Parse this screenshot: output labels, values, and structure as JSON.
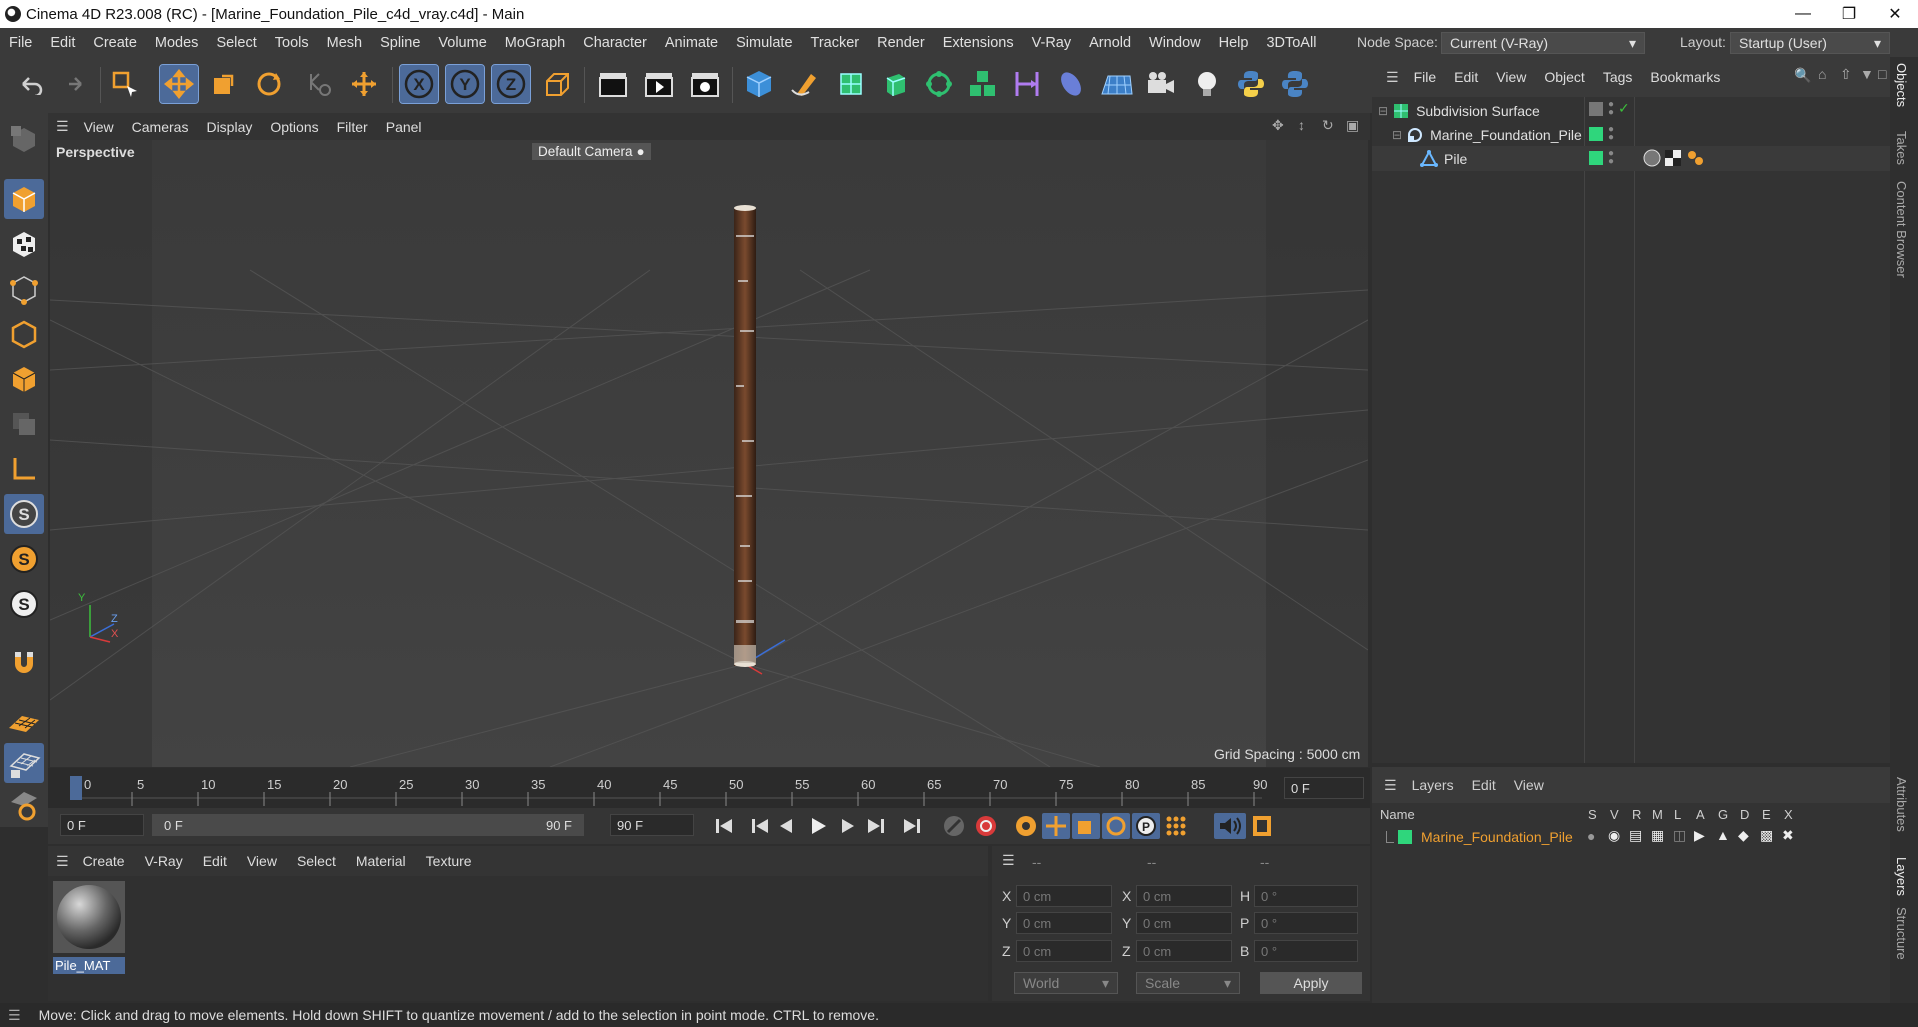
{
  "window": {
    "title": "Cinema 4D R23.008 (RC) - [Marine_Foundation_Pile_c4d_vray.c4d] - Main",
    "controls": [
      "minimize-icon",
      "restore-icon",
      "close-icon"
    ]
  },
  "menubar": {
    "items": [
      "File",
      "Edit",
      "Create",
      "Modes",
      "Select",
      "Tools",
      "Mesh",
      "Spline",
      "Volume",
      "MoGraph",
      "Character",
      "Animate",
      "Simulate",
      "Tracker",
      "Render",
      "Extensions",
      "V-Ray",
      "Arnold",
      "Window",
      "Help",
      "3DToAll"
    ],
    "node_space_label": "Node Space:",
    "node_space_value": "Current (V-Ray)",
    "layout_label": "Layout:",
    "layout_value": "Startup (User)"
  },
  "viewport": {
    "menu": [
      "View",
      "Cameras",
      "Display",
      "Options",
      "Filter",
      "Panel"
    ],
    "label": "Perspective",
    "camera": "Default Camera",
    "grid_spacing": "Grid Spacing : 5000 cm",
    "axis_labels": {
      "y": "Y",
      "z": "Z",
      "x": "X"
    }
  },
  "timeline": {
    "ticks": [
      "0",
      "5",
      "10",
      "15",
      "20",
      "25",
      "30",
      "35",
      "40",
      "45",
      "50",
      "55",
      "60",
      "65",
      "70",
      "75",
      "80",
      "85",
      "90"
    ],
    "current_frame": "0 F"
  },
  "playback": {
    "start": "0 F",
    "range_start": "0 F",
    "range_end": "90 F",
    "end": "90 F"
  },
  "material_manager": {
    "menu": [
      "Create",
      "V-Ray",
      "Edit",
      "View",
      "Select",
      "Material",
      "Texture"
    ],
    "materials": [
      {
        "name": "Pile_MAT"
      }
    ]
  },
  "coordinates": {
    "headers": [
      "--",
      "--",
      "--"
    ],
    "rows": [
      {
        "a_label": "X",
        "a_val": "0 cm",
        "b_label": "X",
        "b_val": "0 cm",
        "c_label": "H",
        "c_val": "0 °"
      },
      {
        "a_label": "Y",
        "a_val": "0 cm",
        "b_label": "Y",
        "b_val": "0 cm",
        "c_label": "P",
        "c_val": "0 °"
      },
      {
        "a_label": "Z",
        "a_val": "0 cm",
        "b_label": "Z",
        "b_val": "0 cm",
        "c_label": "B",
        "c_val": "0 °"
      }
    ],
    "world": "World",
    "scale": "Scale",
    "apply": "Apply"
  },
  "objects_panel": {
    "menu": [
      "File",
      "Edit",
      "View",
      "Object",
      "Tags",
      "Bookmarks"
    ],
    "objects": [
      {
        "name": "Subdivision Surface",
        "indent": 0
      },
      {
        "name": "Marine_Foundation_Pile",
        "indent": 1
      },
      {
        "name": "Pile",
        "indent": 2
      }
    ]
  },
  "layers_panel": {
    "menu": [
      "Layers",
      "Edit",
      "View"
    ],
    "header_name": "Name",
    "header_cols": [
      "S",
      "V",
      "R",
      "M",
      "L",
      "A",
      "G",
      "D",
      "E",
      "X"
    ],
    "layers": [
      {
        "name": "Marine_Foundation_Pile",
        "color": "#2fd67c"
      }
    ]
  },
  "side_tabs": [
    "Objects",
    "Takes",
    "Content Browser",
    "Attributes",
    "Layers",
    "Structure"
  ],
  "status": {
    "text": "Move: Click and drag to move elements. Hold down SHIFT to quantize movement / add to the selection in point mode. CTRL to remove."
  },
  "colors": {
    "accent": "#4c6a99",
    "orange": "#f0a030",
    "layer_green": "#2fd67c"
  }
}
